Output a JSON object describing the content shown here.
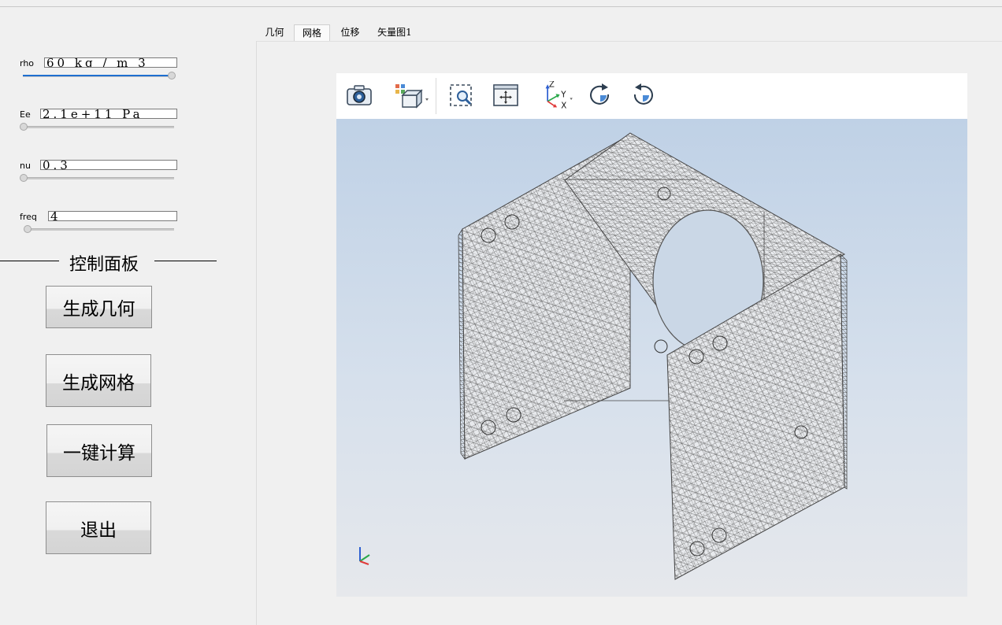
{
  "params": [
    {
      "label": "rho",
      "value": "60 kg / m 3",
      "slider": 1.0
    },
    {
      "label": "Ee",
      "value": "2.1e+11 Pa",
      "slider": 0.0
    },
    {
      "label": "nu",
      "value": "0.3",
      "slider": 0.0
    },
    {
      "label": "freq",
      "value": "4",
      "slider": 0.0
    }
  ],
  "panel": {
    "title": "控制面板",
    "buttons": {
      "gen_geometry": "生成几何",
      "gen_mesh": "生成网格",
      "compute": "一键计算",
      "exit": "退出"
    }
  },
  "tabs": [
    "几何",
    "网格",
    "位移",
    "矢量图1"
  ],
  "active_tab": "网格",
  "toolbar": {
    "icons": [
      "camera-icon",
      "view-cube-icon",
      "zoom-box-icon",
      "fit-view-icon",
      "axis-orientation-icon",
      "rotate-cw-icon",
      "rotate-ccw-icon"
    ],
    "axis_labels": {
      "z": "Z",
      "y": "Y",
      "x": "X"
    }
  },
  "colors": {
    "accent": "#1e6fd0",
    "mesh": "#555555",
    "viewport_top": "#bfd1e6",
    "viewport_bottom": "#e6e8ec"
  }
}
